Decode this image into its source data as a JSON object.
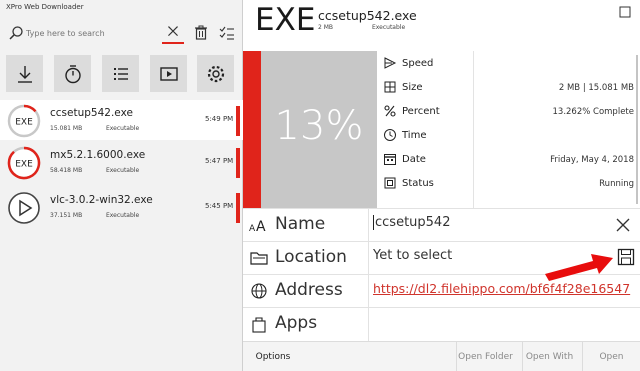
{
  "app": {
    "title": "XPro Web Downloader"
  },
  "search": {
    "placeholder": "Type here to search"
  },
  "toolbar": {
    "buttons": [
      "download-icon",
      "timer-icon",
      "list-icon",
      "video-icon",
      "settings-icon"
    ]
  },
  "downloads": [
    {
      "icon": "EXE",
      "name": "ccsetup542.exe",
      "size": "15.081 MB",
      "type": "Executable",
      "time": "5:49 PM"
    },
    {
      "icon": "EXE",
      "name": "mx5.2.1.6000.exe",
      "size": "58.418 MB",
      "type": "Executable",
      "time": "5:47 PM"
    },
    {
      "icon": "play-icon",
      "name": "vlc-3.0.2-win32.exe",
      "size": "37.151 MB",
      "type": "Executable",
      "time": "5:45 PM"
    }
  ],
  "detail": {
    "type_label": "EXE",
    "name": "ccsetup542.exe",
    "size": "2 MB",
    "type": "Executable",
    "percent_big": "13%",
    "progress_fraction": 0.13262
  },
  "stats": [
    {
      "icon": "speed-icon",
      "label": "Speed",
      "value": ""
    },
    {
      "icon": "size-icon",
      "label": "Size",
      "value": "2 MB | 15.081 MB"
    },
    {
      "icon": "percent-icon",
      "label": "Percent",
      "value": "13.262% Complete"
    },
    {
      "icon": "clock-icon",
      "label": "Time",
      "value": ""
    },
    {
      "icon": "calendar-icon",
      "label": "Date",
      "value": "Friday, May 4, 2018"
    },
    {
      "icon": "status-icon",
      "label": "Status",
      "value": "Running"
    }
  ],
  "fields": {
    "name_label": "Name",
    "name_value": "ccsetup542",
    "location_label": "Location",
    "location_value": "Yet to select",
    "address_label": "Address",
    "address_value": "https://dl2.filehippo.com/bf6f4f28e16547",
    "apps_label": "Apps"
  },
  "actions": {
    "options": "Options",
    "open_folder": "Open Folder",
    "open_with": "Open With",
    "open": "Open"
  },
  "colors": {
    "accent": "#e0241b",
    "progress_bg": "#c7c7c7"
  }
}
